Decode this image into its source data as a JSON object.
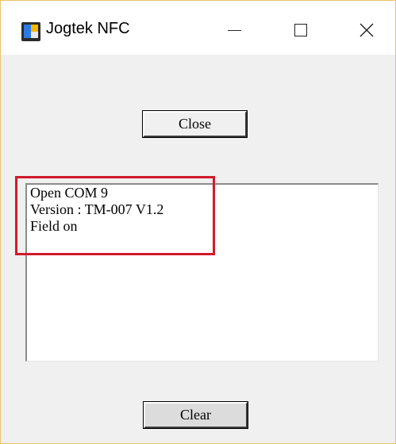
{
  "window": {
    "title": "Jogtek NFC",
    "icon": "jogtek-app-icon",
    "controls": [
      "minimize-icon",
      "maximize-icon",
      "close-icon"
    ]
  },
  "buttons": {
    "close_label": "Close",
    "clear_label": "Clear"
  },
  "log": {
    "lines": [
      "Open COM 9",
      "Version : TM-007 V1.2",
      "Field on"
    ]
  },
  "highlight": {
    "color": "#d11a2a"
  }
}
